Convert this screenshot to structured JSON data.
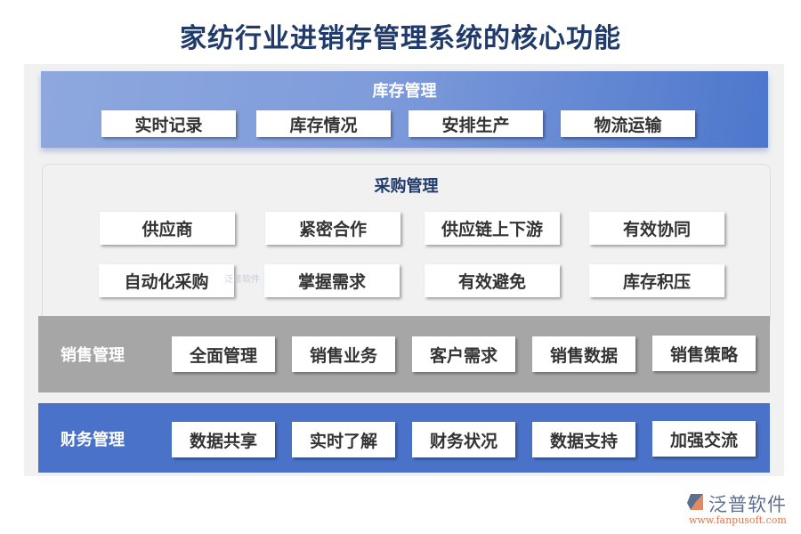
{
  "title": "家纺行业进销存管理系统的核心功能",
  "sections": {
    "inventory": {
      "title": "库存管理",
      "items": [
        "实时记录",
        "库存情况",
        "安排生产",
        "物流运输"
      ]
    },
    "purchase": {
      "title": "采购管理",
      "row1": [
        "供应商",
        "紧密合作",
        "供应链上下游",
        "有效协同"
      ],
      "row2": [
        "自动化采购",
        "掌握需求",
        "有效避免",
        "库存积压"
      ]
    },
    "sales": {
      "title": "销售管理",
      "items": [
        "全面管理",
        "销售业务",
        "客户需求",
        "销售数据",
        "销售策略"
      ]
    },
    "finance": {
      "title": "财务管理",
      "items": [
        "数据共享",
        "实时了解",
        "财务状况",
        "数据支持",
        "加强交流"
      ]
    }
  },
  "watermark": "泛普软件",
  "logo": {
    "brand": "泛普软件",
    "url": "www.fanpusoft.com"
  },
  "colors": {
    "title": "#1f3a6b",
    "inventory_start": "#8ea8de",
    "inventory_end": "#4d77cc",
    "sales": "#a6a6a6",
    "finance": "#4a72c8",
    "logo_text": "#5d6f8e",
    "logo_url": "#e0764a"
  }
}
